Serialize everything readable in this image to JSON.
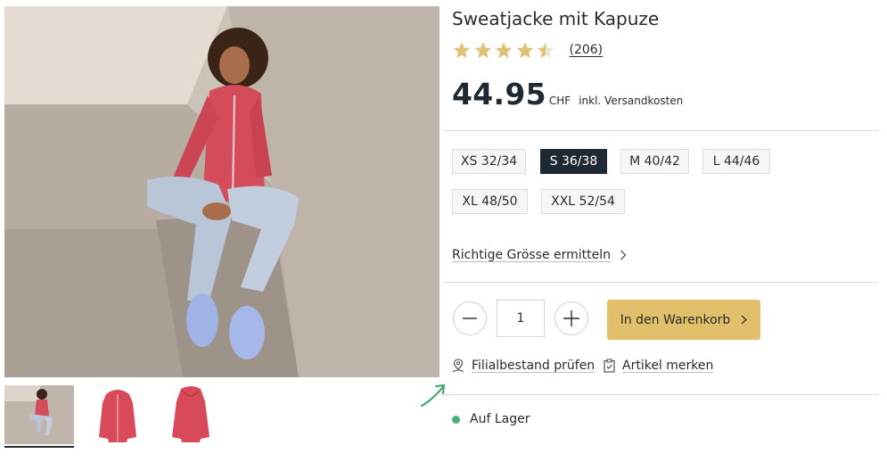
{
  "product": {
    "title": "Sweatjacke mit Kapuze",
    "rating": 4.5,
    "review_count": "(206)",
    "price": "44.95",
    "currency": "CHF",
    "shipping_note": "inkl. Versandkosten"
  },
  "sizes": [
    {
      "label": "XS 32/34",
      "selected": false
    },
    {
      "label": "S 36/38",
      "selected": true
    },
    {
      "label": "M 40/42",
      "selected": false
    },
    {
      "label": "L 44/46",
      "selected": false
    },
    {
      "label": "XL 48/50",
      "selected": false
    },
    {
      "label": "XXL 52/54",
      "selected": false
    }
  ],
  "size_guide_link": "Richtige Grösse ermitteln",
  "quantity": {
    "value": "1"
  },
  "cart_button": "In den Warenkorb",
  "actions": {
    "store_stock": "Filialbestand prüfen",
    "wishlist": "Artikel merken"
  },
  "availability": "Auf Lager",
  "colors": {
    "accent": "#e2c06b",
    "selected_size": "#1f2933",
    "stock_ok": "#4caf7a",
    "star": "#e0c074",
    "product": "#d84a5a"
  },
  "icons": [
    "star-icon",
    "chevron-right-icon",
    "minus-icon",
    "plus-icon",
    "store-pin-icon",
    "clipboard-check-icon"
  ]
}
